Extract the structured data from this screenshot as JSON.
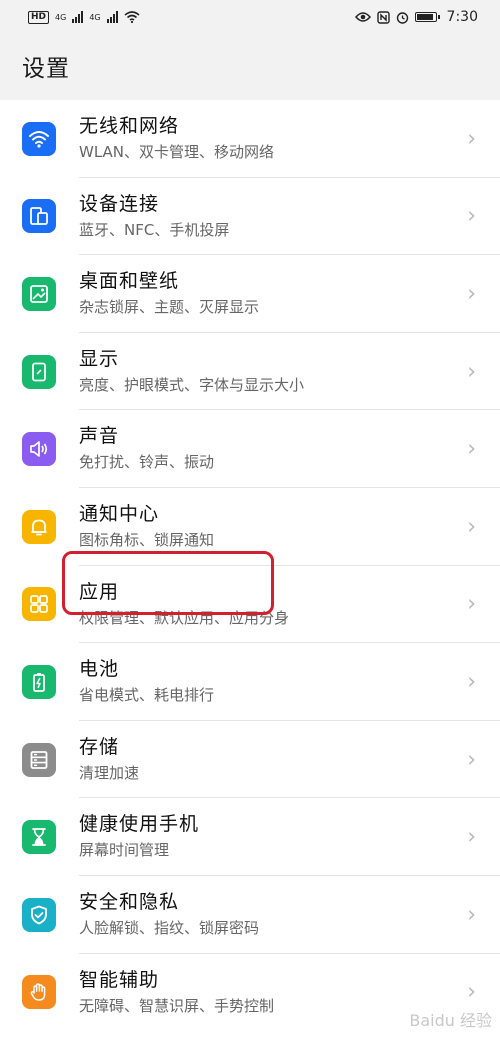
{
  "status_bar": {
    "network_1": "4G",
    "network_2": "4G",
    "time": "7:30",
    "hd_badge": "HD"
  },
  "header": {
    "title": "设置"
  },
  "settings": [
    {
      "title": "无线和网络",
      "subtitle": "WLAN、双卡管理、移动网络",
      "icon": "wifi-icon",
      "color": "#1a6ef5"
    },
    {
      "title": "设备连接",
      "subtitle": "蓝牙、NFC、手机投屏",
      "icon": "device-connect-icon",
      "color": "#1a6ef5"
    },
    {
      "title": "桌面和壁纸",
      "subtitle": "杂志锁屏、主题、灭屏显示",
      "icon": "wallpaper-icon",
      "color": "#19b86f"
    },
    {
      "title": "显示",
      "subtitle": "亮度、护眼模式、字体与显示大小",
      "icon": "display-icon",
      "color": "#19b86f"
    },
    {
      "title": "声音",
      "subtitle": "免打扰、铃声、振动",
      "icon": "sound-icon",
      "color": "#8a5cf0"
    },
    {
      "title": "通知中心",
      "subtitle": "图标角标、锁屏通知",
      "icon": "bell-icon",
      "color": "#f7b500"
    },
    {
      "title": "应用",
      "subtitle": "权限管理、默认应用、应用分身",
      "icon": "apps-icon",
      "color": "#f7b500"
    },
    {
      "title": "电池",
      "subtitle": "省电模式、耗电排行",
      "icon": "battery-icon",
      "color": "#19b86f"
    },
    {
      "title": "存储",
      "subtitle": "清理加速",
      "icon": "storage-icon",
      "color": "#8c8c8c"
    },
    {
      "title": "健康使用手机",
      "subtitle": "屏幕时间管理",
      "icon": "hourglass-icon",
      "color": "#19b86f"
    },
    {
      "title": "安全和隐私",
      "subtitle": "人脸解锁、指纹、锁屏密码",
      "icon": "shield-icon",
      "color": "#1ab0c8"
    },
    {
      "title": "智能辅助",
      "subtitle": "无障碍、智慧识屏、手势控制",
      "icon": "hand-icon",
      "color": "#f58a1f"
    }
  ],
  "highlighted_item": "电池",
  "watermark": "Baidu 经验"
}
